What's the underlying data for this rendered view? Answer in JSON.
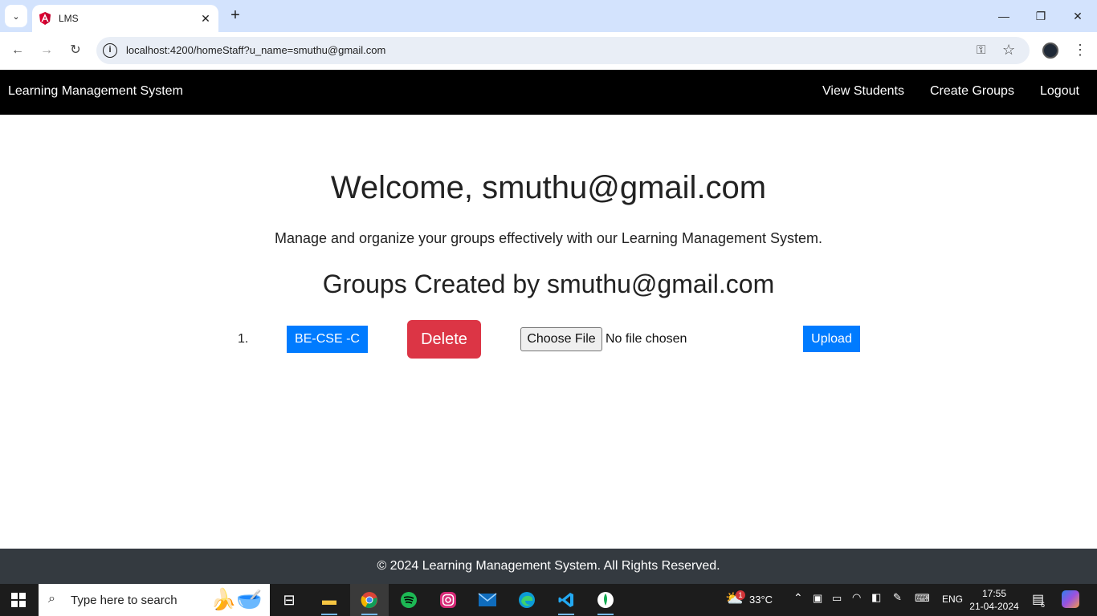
{
  "browser": {
    "tab_title": "LMS",
    "new_tab_label": "+",
    "url": "localhost:4200/homeStaff?u_name=smuthu@gmail.com"
  },
  "navbar": {
    "brand": "Learning Management System",
    "links": [
      "View Students",
      "Create Groups",
      "Logout"
    ]
  },
  "main": {
    "welcome": "Welcome, smuthu@gmail.com",
    "subtitle": "Manage and organize your groups effectively with our Learning Management System.",
    "groups_title": "Groups Created by smuthu@gmail.com",
    "groups": [
      {
        "index": "1.",
        "name": "BE-CSE -C",
        "delete_label": "Delete",
        "choose_file_label": "Choose File",
        "file_status": "No file chosen",
        "upload_label": "Upload"
      }
    ]
  },
  "footer": {
    "text": "© 2024 Learning Management System. All Rights Reserved."
  },
  "taskbar": {
    "search_placeholder": "Type here to search",
    "weather_temp": "33°C",
    "weather_badge": "1",
    "language": "ENG",
    "time": "17:55",
    "date": "21-04-2024",
    "notification_count": "6"
  },
  "colors": {
    "primary": "#007bff",
    "danger": "#dc3545",
    "navbar_bg": "#000000",
    "footer_bg": "#343a40",
    "tabstrip_bg": "#d3e3fd"
  }
}
